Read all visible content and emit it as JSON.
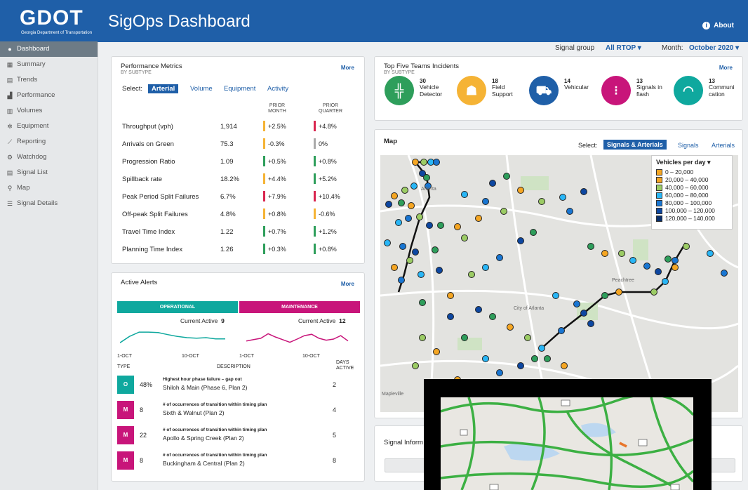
{
  "header": {
    "logo": "GDOT",
    "logo_sub": "Georgia Department of Transportation",
    "title": "SigOps Dashboard",
    "about": "About"
  },
  "sidebar": {
    "items": [
      {
        "label": "Dashboard",
        "icon": "dashboard-icon",
        "glyph": "●"
      },
      {
        "label": "Summary",
        "icon": "table-icon",
        "glyph": "▦"
      },
      {
        "label": "Trends",
        "icon": "document-icon",
        "glyph": "▤"
      },
      {
        "label": "Performance",
        "icon": "bar-chart-icon",
        "glyph": "▟"
      },
      {
        "label": "Volumes",
        "icon": "grid-icon",
        "glyph": "▥"
      },
      {
        "label": "Equipment",
        "icon": "gear-icon",
        "glyph": "✲"
      },
      {
        "label": "Reporting",
        "icon": "line-chart-icon",
        "glyph": "⟋"
      },
      {
        "label": "Watchdog",
        "icon": "shield-icon",
        "glyph": "⚙"
      },
      {
        "label": "Signal List",
        "icon": "list-icon",
        "glyph": "▤"
      },
      {
        "label": "Map",
        "icon": "map-pin-icon",
        "glyph": "⚲"
      },
      {
        "label": "Signal Details",
        "icon": "database-icon",
        "glyph": "☰"
      }
    ]
  },
  "filters": {
    "signal_group_label": "Signal group",
    "signal_group_value": "All RTOP",
    "month_label": "Month:",
    "month_value": "October 2020"
  },
  "metrics": {
    "title": "Performance Metrics",
    "subtitle": "BY SUBTYPE",
    "more": "More",
    "select_label": "Select:",
    "tabs": [
      "Arterial",
      "Volume",
      "Equipment",
      "Activity"
    ],
    "col_month": "PRIOR MONTH",
    "col_quarter": "PRIOR QUARTER",
    "rows": [
      {
        "name": "Throughput (vph)",
        "value": "1,914",
        "month": "+2.5%",
        "month_color": "#f5b335",
        "quarter": "+4.8%",
        "quarter_color": "#d9254e"
      },
      {
        "name": "Arrivals on Green",
        "value": "75.3",
        "month": "-0.3%",
        "month_color": "#f5b335",
        "quarter": "0%",
        "quarter_color": "#aaaaaa"
      },
      {
        "name": "Progression Ratio",
        "value": "1.09",
        "month": "+0.5%",
        "month_color": "#2e9e5b",
        "quarter": "+0.8%",
        "quarter_color": "#2e9e5b"
      },
      {
        "name": "Spillback rate",
        "value": "18.2%",
        "month": "+4.4%",
        "month_color": "#f5b335",
        "quarter": "+5.2%",
        "quarter_color": "#2e9e5b"
      },
      {
        "name": "Peak Period Split Failures",
        "value": "6.7%",
        "month": "+7.9%",
        "month_color": "#d9254e",
        "quarter": "+10.4%",
        "quarter_color": "#d9254e"
      },
      {
        "name": "Off-peak Split Failures",
        "value": "4.8%",
        "month": "+0.8%",
        "month_color": "#f5b335",
        "quarter": "-0.6%",
        "quarter_color": "#f5b335"
      },
      {
        "name": "Travel Time Index",
        "value": "1.22",
        "month": "+0.7%",
        "month_color": "#2e9e5b",
        "quarter": "+1.2%",
        "quarter_color": "#2e9e5b"
      },
      {
        "name": "Planning Time Index",
        "value": "1.26",
        "month": "+0.3%",
        "month_color": "#2e9e5b",
        "quarter": "+0.8%",
        "quarter_color": "#2e9e5b"
      }
    ]
  },
  "incidents": {
    "title": "Top Five Teams Incidents",
    "subtitle": "BY SUBTYPE",
    "more": "More",
    "items": [
      {
        "count": "30",
        "label": "Vehicle Detector",
        "color": "#2e9e5b",
        "icon": "road-icon",
        "glyph": "╬"
      },
      {
        "count": "18",
        "label": "Field Support",
        "color": "#f5b335",
        "icon": "worker-icon",
        "glyph": "☗"
      },
      {
        "count": "14",
        "label": "Vehicular",
        "color": "#1f5fa8",
        "icon": "car-crash-icon",
        "glyph": "⛟"
      },
      {
        "count": "13",
        "label": "Signals in flash",
        "color": "#c8157a",
        "icon": "traffic-light-icon",
        "glyph": "⁝"
      },
      {
        "count": "13",
        "label": "Communi cation",
        "color": "#0fa89e",
        "icon": "wifi-icon",
        "glyph": "◠"
      }
    ]
  },
  "map": {
    "title": "Map",
    "select_label": "Select:",
    "btn_active": "Signals & Arterials",
    "btn_signals": "Signals",
    "btn_arterials": "Arterials",
    "legend_title": "Vehicles per day",
    "legend": [
      {
        "range": "0 – 20,000",
        "color": "#f5a623"
      },
      {
        "range": "20,000 – 40,000",
        "color": "#f5a623"
      },
      {
        "range": "40,000 – 60,000",
        "color": "#9ccc65"
      },
      {
        "range": "60,000 – 80,000",
        "color": "#29b6f6"
      },
      {
        "range": "80,000 – 100,000",
        "color": "#1976d2"
      },
      {
        "range": "100,000 – 120,000",
        "color": "#0d47a1"
      },
      {
        "range": "120,000 – 140,000",
        "color": "#0a2f6b"
      }
    ],
    "place_labels": [
      "Atlanta",
      "Mapleville",
      "City of Atlanta",
      "Peachtree"
    ]
  },
  "alerts": {
    "title": "Active Alerts",
    "more": "More",
    "operational": "OPERATIONAL",
    "maintenance": "MAINTENANCE",
    "op_active_label": "Current Active",
    "op_active_value": "9",
    "mt_active_label": "Current Active",
    "mt_active_value": "12",
    "op_x1": "1-OCT",
    "op_x2": "10-OCT",
    "mt_x1": "1-OCT",
    "mt_x2": "10-OCT",
    "col_type": "TYPE",
    "col_desc": "DESCRIPTION",
    "col_days": "DAYS ACTIVE",
    "op_trend": [
      0.3,
      0.55,
      0.72,
      0.72,
      0.7,
      0.62,
      0.55,
      0.5,
      0.48,
      0.5,
      0.45,
      0.45
    ],
    "mt_trend": [
      0.35,
      0.4,
      0.45,
      0.62,
      0.5,
      0.4,
      0.3,
      0.42,
      0.55,
      0.6,
      0.45,
      0.38,
      0.42,
      0.55,
      0.35
    ],
    "rows": [
      {
        "badge": "O",
        "color": "#0fa89e",
        "num": "48%",
        "title": "Highest hour phase failure – gap out",
        "desc": "Shiloh & Main (Phase 6, Plan 2)",
        "days": "2"
      },
      {
        "badge": "M",
        "color": "#c8157a",
        "num": "8",
        "title": "# of occurrences of transition within timing plan",
        "desc": "Sixth & Walnut (Plan 2)",
        "days": "4"
      },
      {
        "badge": "M",
        "color": "#c8157a",
        "num": "22",
        "title": "# of occurrences of transition within timing plan",
        "desc": "Apollo & Spring Creek (Plan 2)",
        "days": "5"
      },
      {
        "badge": "M",
        "color": "#c8157a",
        "num": "8",
        "title": "# of occurrences of transition within timing plan",
        "desc": "Buckingham & Central (Plan 2)",
        "days": "8"
      }
    ]
  },
  "signal_info": {
    "title": "Signal Inform"
  }
}
